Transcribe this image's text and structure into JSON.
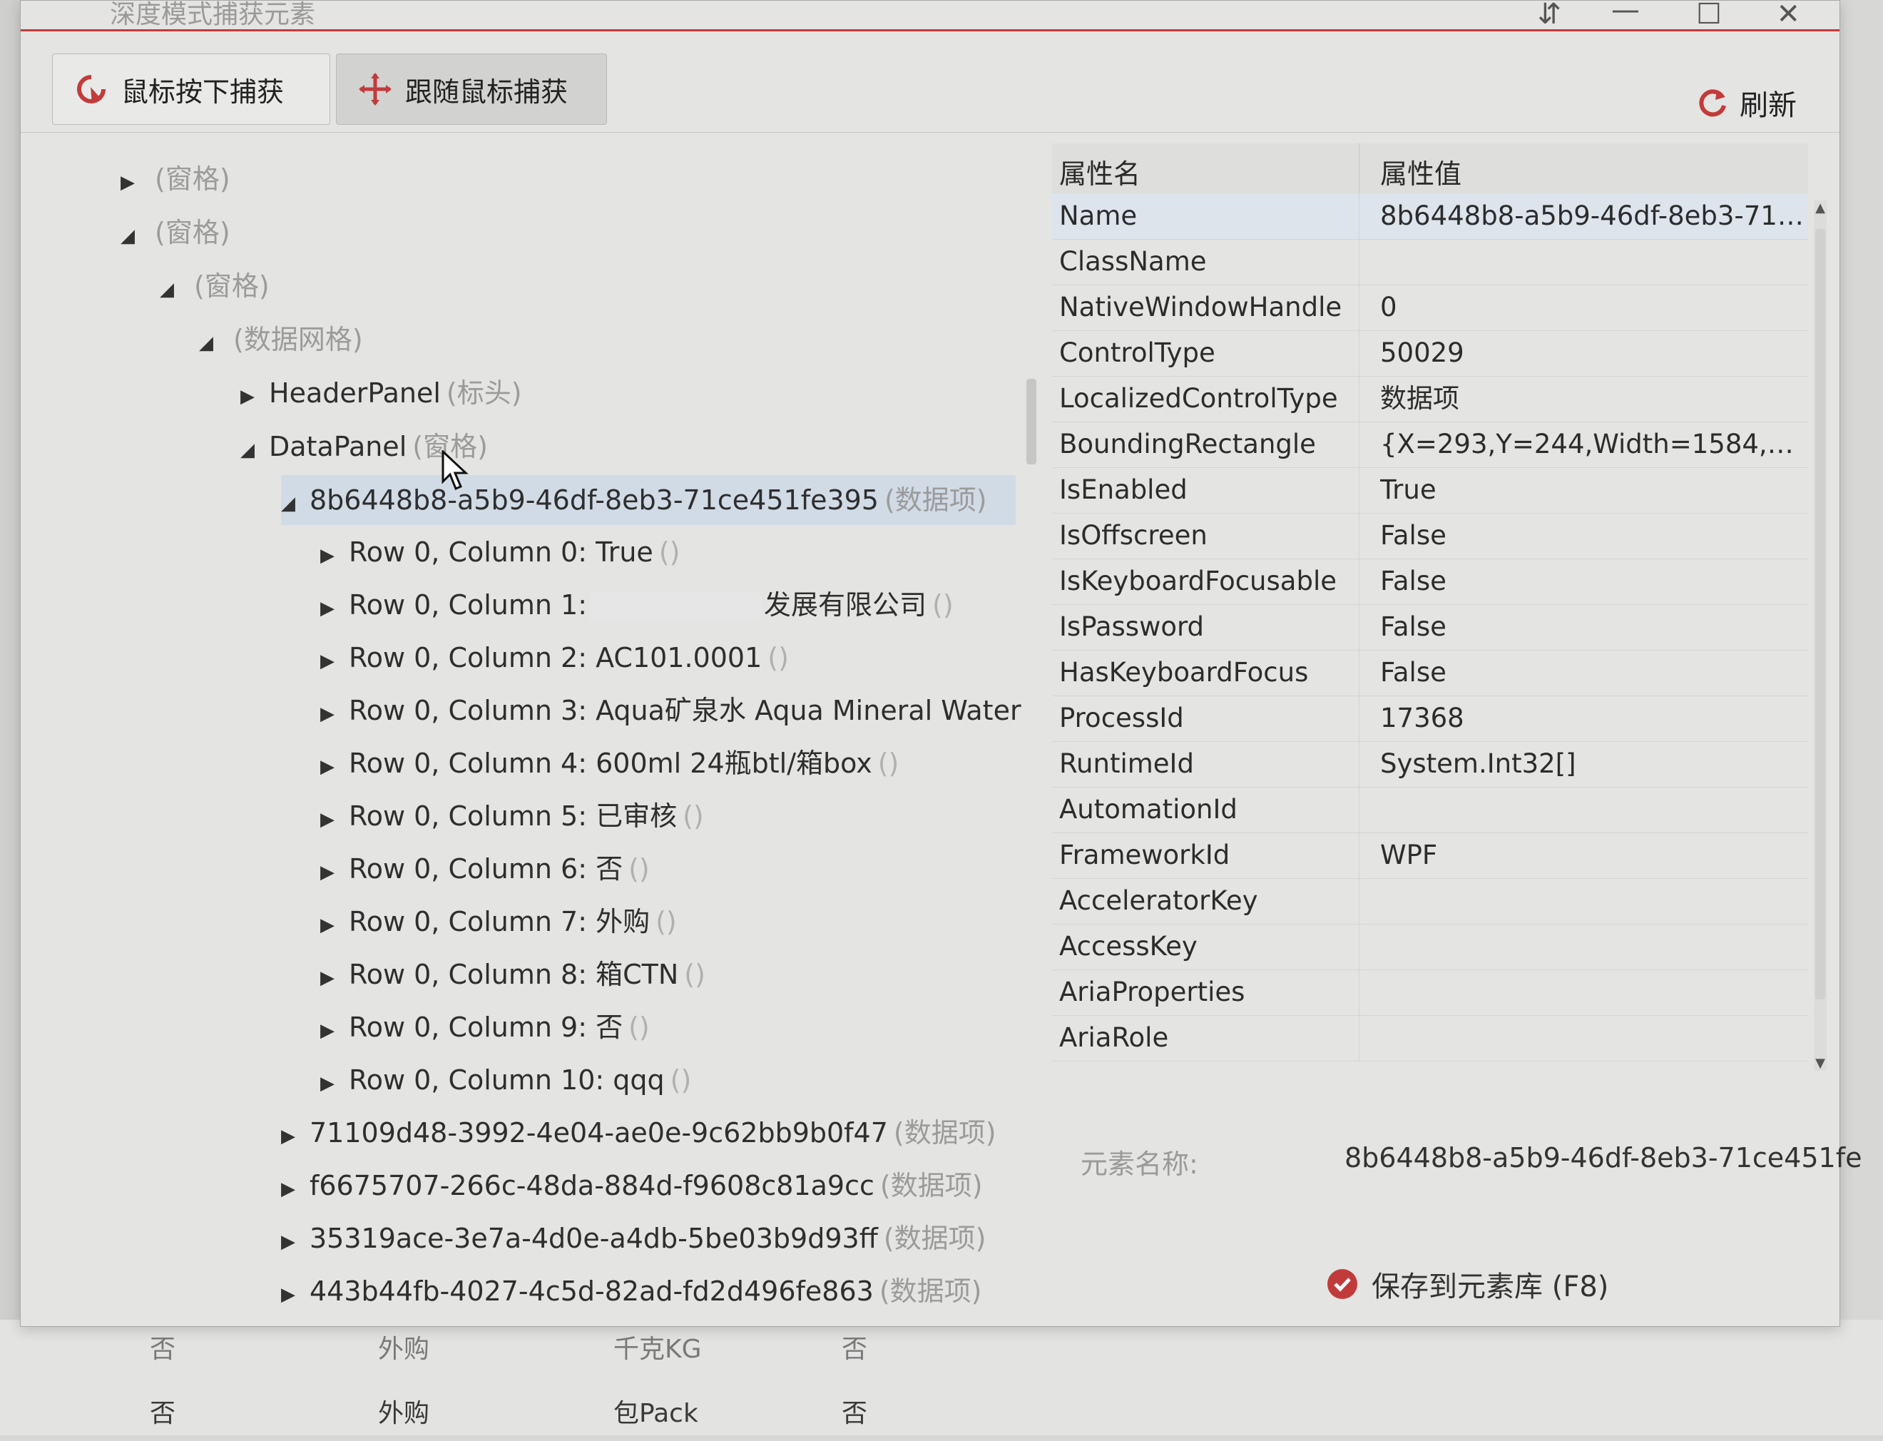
{
  "window": {
    "title": "深度模式捕获元素"
  },
  "toolbar": {
    "capture_on_click_label": "鼠标按下捕获",
    "follow_mouse_label": "跟随鼠标捕获",
    "refresh_label": "刷新"
  },
  "tree": {
    "nodes": [
      {
        "text": "",
        "type": "(窗格)",
        "arrow": "▶"
      },
      {
        "text": "",
        "type": "(窗格)",
        "arrow": "◢"
      },
      {
        "text": "",
        "type": "(窗格)",
        "arrow": "◢"
      },
      {
        "text": "",
        "type": "(数据网格)",
        "arrow": "◢"
      },
      {
        "text": "HeaderPanel",
        "type": "(标头)",
        "arrow": "▶"
      },
      {
        "text": "DataPanel",
        "type": "(窗格)",
        "arrow": "◢"
      },
      {
        "text": "8b6448b8-a5b9-46df-8eb3-71ce451fe395",
        "type": "(数据项)",
        "arrow": "◢"
      },
      {
        "text": "Row 0, Column 0: True",
        "type": "()",
        "arrow": "▶"
      },
      {
        "text_prefix": "Row 0, Column 1:",
        "text_suffix": "发展有限公司",
        "type": "()",
        "arrow": "▶"
      },
      {
        "text": "Row 0, Column 2: AC101.0001",
        "type": "()",
        "arrow": "▶"
      },
      {
        "text": "Row 0, Column 3: Aqua矿泉水 Aqua Mineral Water",
        "type": "",
        "arrow": "▶"
      },
      {
        "text": "Row 0, Column 4: 600ml 24瓶btl/箱box",
        "type": "()",
        "arrow": "▶"
      },
      {
        "text": "Row 0, Column 5: 已审核",
        "type": "()",
        "arrow": "▶"
      },
      {
        "text": "Row 0, Column 6: 否",
        "type": "()",
        "arrow": "▶"
      },
      {
        "text": "Row 0, Column 7: 外购",
        "type": "()",
        "arrow": "▶"
      },
      {
        "text": "Row 0, Column 8: 箱CTN",
        "type": "()",
        "arrow": "▶"
      },
      {
        "text": "Row 0, Column 9: 否",
        "type": "()",
        "arrow": "▶"
      },
      {
        "text": "Row 0, Column 10: qqq",
        "type": "()",
        "arrow": "▶"
      },
      {
        "text": "71109d48-3992-4e04-ae0e-9c62bb9b0f47",
        "type": "(数据项)",
        "arrow": "▶"
      },
      {
        "text": "f6675707-266c-48da-884d-f9608c81a9cc",
        "type": "(数据项)",
        "arrow": "▶"
      },
      {
        "text": "35319ace-3e7a-4d0e-a4db-5be03b9d93ff",
        "type": "(数据项)",
        "arrow": "▶"
      },
      {
        "text": "443b44fb-4027-4c5d-82ad-fd2d496fe863",
        "type": "(数据项)",
        "arrow": "▶"
      }
    ]
  },
  "properties": {
    "header_name": "属性名",
    "header_value": "属性值",
    "rows": [
      {
        "name": "Name",
        "value": "8b6448b8-a5b9-46df-8eb3-71c..."
      },
      {
        "name": "ClassName",
        "value": ""
      },
      {
        "name": "NativeWindowHandle",
        "value": "0"
      },
      {
        "name": "ControlType",
        "value": "50029"
      },
      {
        "name": "LocalizedControlType",
        "value": "数据项"
      },
      {
        "name": "BoundingRectangle",
        "value": "{X=293,Y=244,Width=1584,Heig..."
      },
      {
        "name": "IsEnabled",
        "value": "True"
      },
      {
        "name": "IsOffscreen",
        "value": "False"
      },
      {
        "name": "IsKeyboardFocusable",
        "value": "False"
      },
      {
        "name": "IsPassword",
        "value": "False"
      },
      {
        "name": "HasKeyboardFocus",
        "value": "False"
      },
      {
        "name": "ProcessId",
        "value": "17368"
      },
      {
        "name": "RuntimeId",
        "value": "System.Int32[]"
      },
      {
        "name": "AutomationId",
        "value": ""
      },
      {
        "name": "FrameworkId",
        "value": "WPF"
      },
      {
        "name": "AcceleratorKey",
        "value": ""
      },
      {
        "name": "AccessKey",
        "value": ""
      },
      {
        "name": "AriaProperties",
        "value": ""
      },
      {
        "name": "AriaRole",
        "value": ""
      }
    ]
  },
  "element": {
    "label": "元素名称:",
    "value": "8b6448b8-a5b9-46df-8eb3-71ce451fe"
  },
  "save": {
    "label": "保存到元素库 (F8)"
  },
  "background_grid": {
    "row1": [
      "否",
      "外购",
      "千克KG",
      "否"
    ],
    "row2": [
      "否",
      "外购",
      "包Pack",
      "否"
    ]
  },
  "colors": {
    "accent_red": "#c23b3b",
    "selection": "#d1dbe6"
  }
}
